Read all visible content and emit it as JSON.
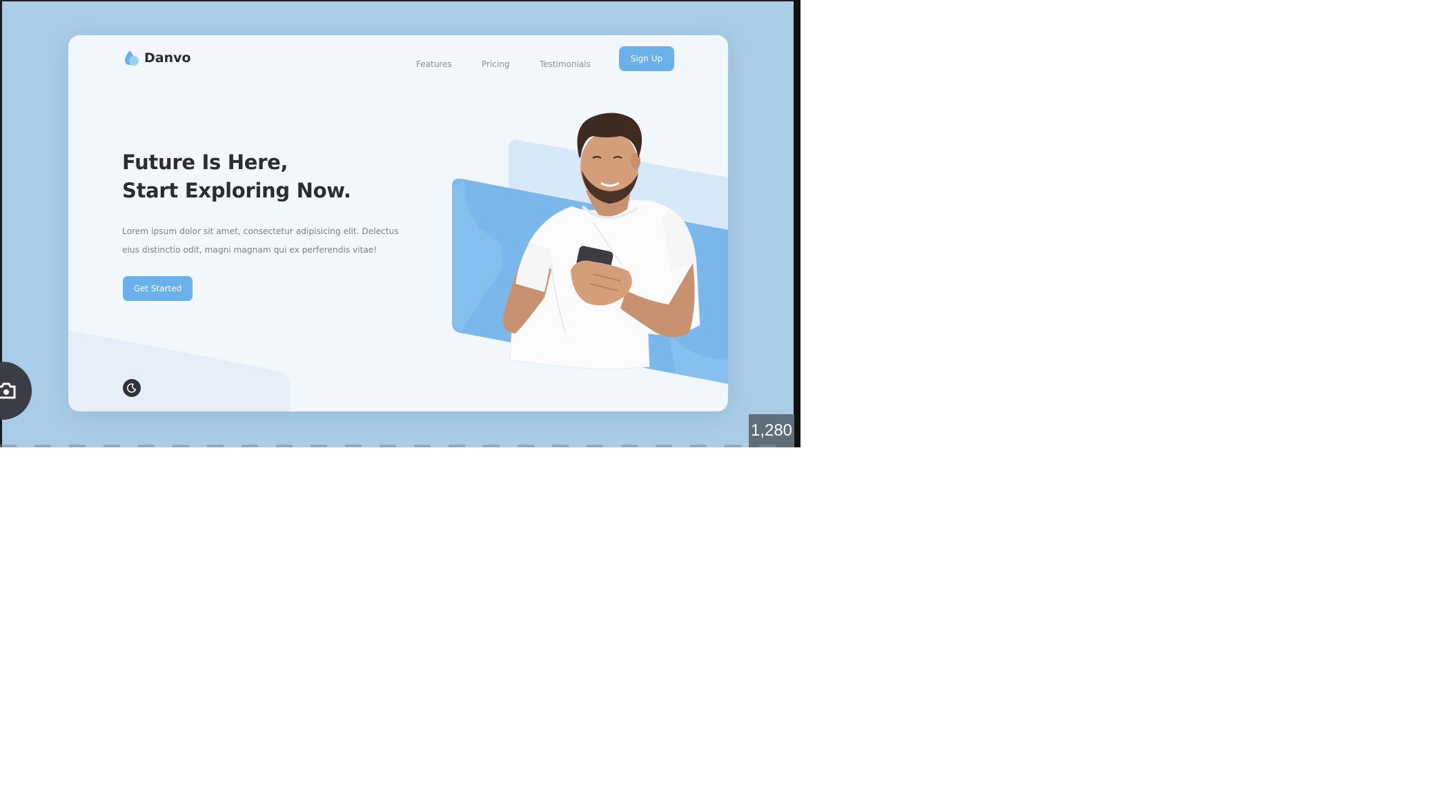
{
  "brand": {
    "name": "Danvo",
    "logo_icon": "water-drop-icon"
  },
  "nav": {
    "links": [
      "Features",
      "Pricing",
      "Testimonials"
    ],
    "signup_label": "Sign Up"
  },
  "hero": {
    "headline_line1": "Future Is Here,",
    "headline_line2": "Start Exploring Now.",
    "description_line1": "Lorem ipsum dolor sit amet, consectetur adipisicing elit. Delectus",
    "description_line2": "eius distinctio odit, magni magnam qui ex perferendis vitae!",
    "cta_label": "Get Started",
    "image": "man-using-smartphone-photo"
  },
  "theme_toggle": {
    "icon": "moon-icon"
  },
  "overlay": {
    "side_button_icon": "camera-icon",
    "size_badge": "1,280"
  },
  "colors": {
    "accent": "#6ab0ea",
    "heading": "#2b2d33",
    "background": "#a9cde6",
    "card": "#f2f7fc"
  }
}
